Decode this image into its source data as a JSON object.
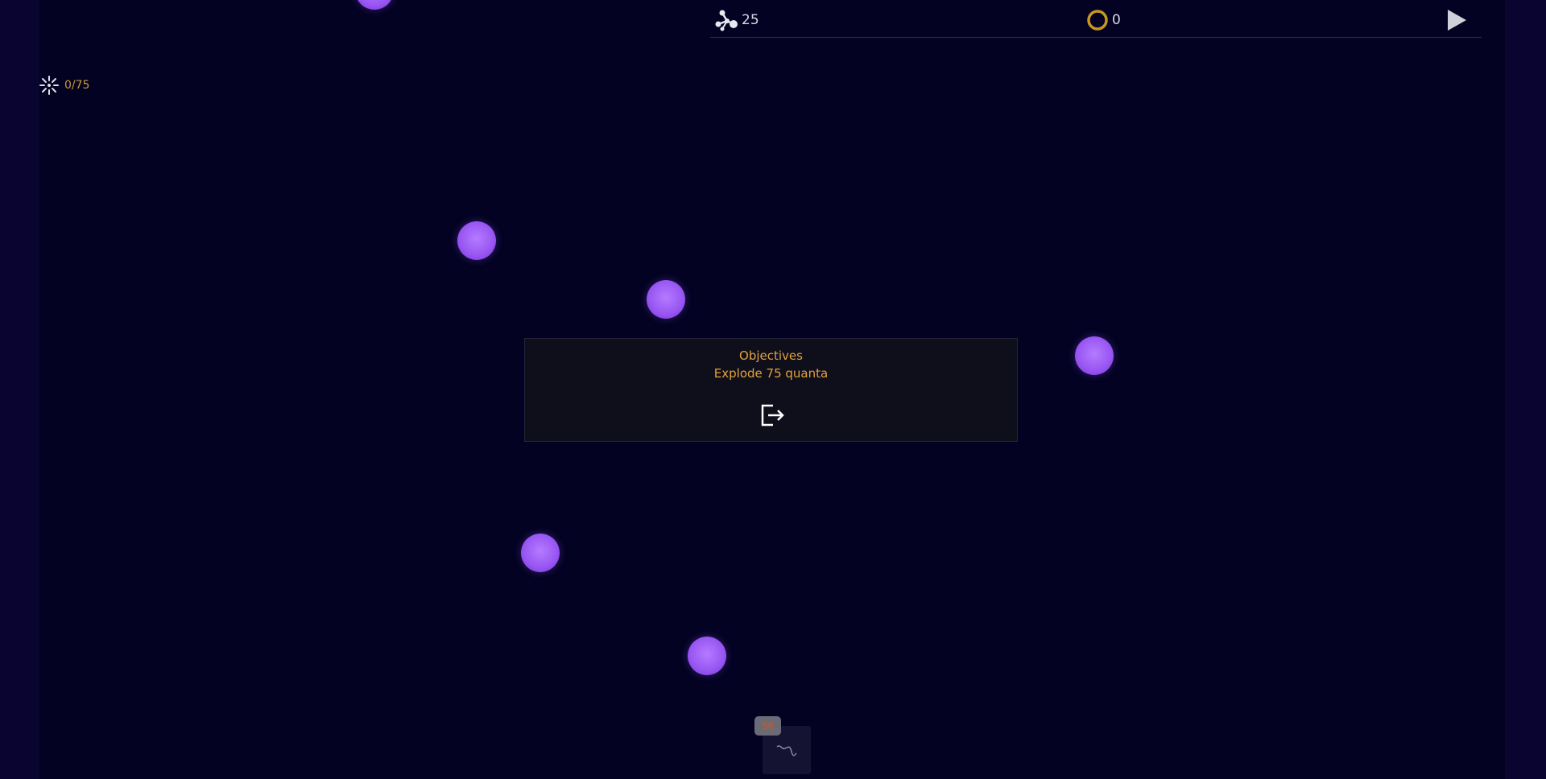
{
  "top_bar": {
    "quanta_count": "25",
    "quanta_icon": "molecule-icon",
    "ring_count": "0",
    "ring_icon": "ring-icon",
    "play_icon": "play-icon"
  },
  "exploded": {
    "icon": "burst-icon",
    "value": "0/75"
  },
  "objectives": {
    "title": "Objectives",
    "text": "Explode 75 quanta",
    "exit_icon": "exit-icon"
  },
  "tool": {
    "badge": "58",
    "icon": "squiggle-icon"
  },
  "colors": {
    "background": "#030222",
    "quantum": "#9a58f3",
    "accent": "#e3a23a"
  },
  "quanta_visible": 7
}
